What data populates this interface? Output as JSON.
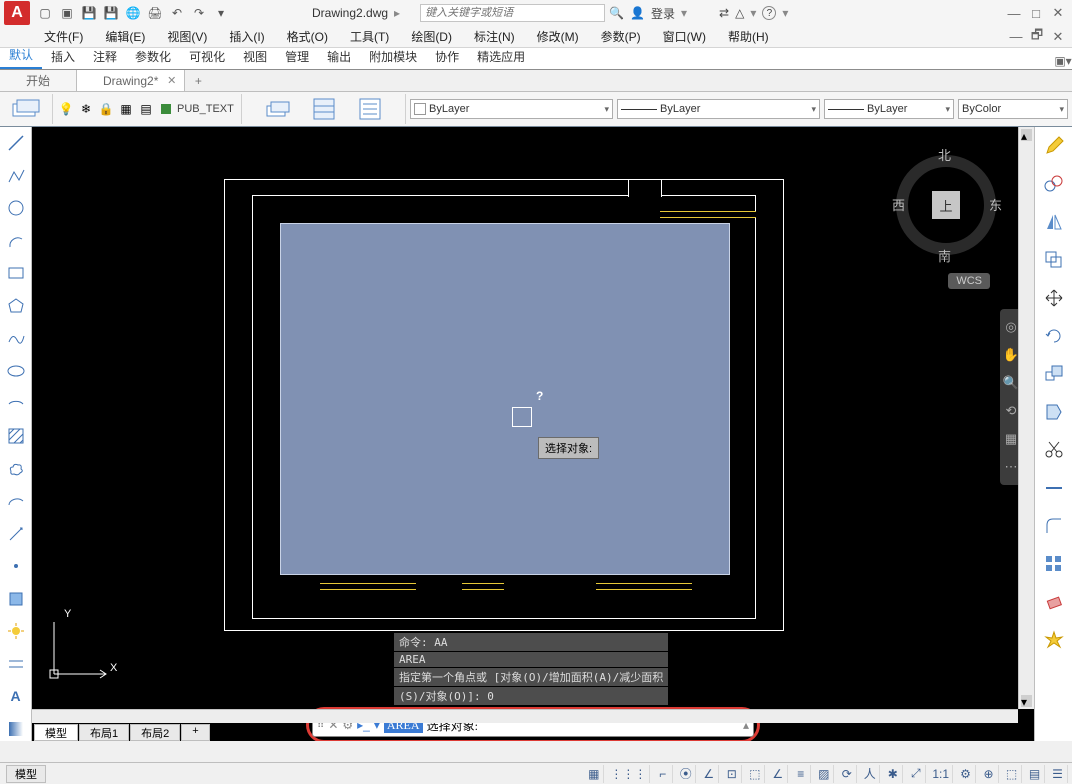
{
  "title": "Drawing2.dwg",
  "search_placeholder": "键入关键字或短语",
  "login_label": "登录",
  "menu": [
    "文件(F)",
    "编辑(E)",
    "视图(V)",
    "插入(I)",
    "格式(O)",
    "工具(T)",
    "绘图(D)",
    "标注(N)",
    "修改(M)",
    "参数(P)",
    "窗口(W)",
    "帮助(H)"
  ],
  "ribbon_tabs": [
    "默认",
    "插入",
    "注释",
    "参数化",
    "可视化",
    "视图",
    "管理",
    "输出",
    "附加模块",
    "协作",
    "精选应用"
  ],
  "ribbon_active": 0,
  "file_tabs": [
    {
      "label": "开始",
      "active": false
    },
    {
      "label": "Drawing2*",
      "active": true
    }
  ],
  "layer_name": "PUB_TEXT",
  "combo_layercolor": "ByLayer",
  "combo_linetype": "ByLayer",
  "combo_lineweight": "ByLayer",
  "combo_plotstyle": "ByColor",
  "viewcube": {
    "n": "北",
    "s": "南",
    "e": "东",
    "w": "西",
    "top": "上",
    "wcs": "WCS"
  },
  "tooltip_text": "选择对象:",
  "cmd_history": [
    "命令: AA",
    "AREA",
    "指定第一个角点或 [对象(O)/增加面积(A)/减少面积"
  ],
  "cmd_history_frag": "(S)/对象(O)]: 0",
  "cmd_input_prefix": "AREA",
  "cmd_input_text": " 选择对象:",
  "layout_tabs": [
    "模型",
    "布局1",
    "布局2"
  ],
  "status_model": "模型",
  "status_scale": "1:1",
  "icons": {
    "search": "🔍",
    "user": "👤",
    "cart": "⎋",
    "cloud": "☁",
    "help": "?",
    "min": "—",
    "max": "□",
    "close": "✕"
  }
}
